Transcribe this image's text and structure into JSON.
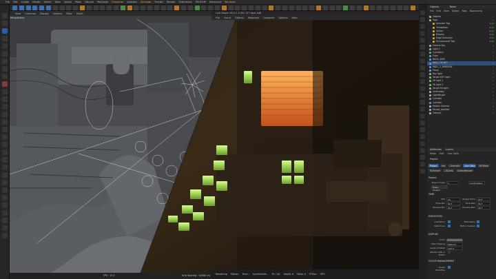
{
  "menubar": [
    "File",
    "Edit",
    "Create",
    "Modes",
    "Select",
    "Tools",
    "Spline",
    "Mesh",
    "Volume",
    "MoGraph",
    "Character",
    "Animate",
    "Simulate",
    "Tracker",
    "Render",
    "Extensions",
    "EXOFILM",
    "Enhanced",
    "Windows"
  ],
  "viewport_menu": [
    "View",
    "Cameras",
    "Display",
    "Options",
    "Filter",
    "Panel"
  ],
  "viewport_label": "Perspective",
  "render_title": "Live Viewer 2021.1.0 (Rd. 377 days left)",
  "render_menu": [
    "File",
    "Cloud",
    "Objects",
    "Materials",
    "Compare",
    "Options",
    "Help"
  ],
  "status_left": {
    "fps": "FPS : 13.5",
    "grid": "Grid Spacing : 10000 cm"
  },
  "status_right": [
    "Rendering",
    "Mb/sec",
    "Time :",
    "SyncFriends...",
    "Tri: 101",
    "Depth: 0",
    "Mesh: 0",
    "RTXon",
    "GPU"
  ],
  "objects_panel": {
    "title": "Objects",
    "tab2": "Takes",
    "menu": [
      "File",
      "Edit",
      "View",
      "Object",
      "Tags",
      "Bookmarks"
    ],
    "rows": [
      {
        "label": "Objects",
        "icon": "w"
      },
      {
        "label": "Tags",
        "icon": "o"
      },
      {
        "label": "Animate Tag",
        "icon": "o",
        "check": "3.00"
      },
      {
        "label": "Translation",
        "icon": "o",
        "check": "3.00"
      },
      {
        "label": "Spline",
        "icon": "o",
        "check": "3.00"
      },
      {
        "label": "Display",
        "icon": "o",
        "check": "3.00"
      },
      {
        "label": "Edge Selection",
        "icon": "o",
        "check": "3.00"
      },
      {
        "label": "Environment Tag",
        "icon": "o",
        "check": "3.00"
      },
      {
        "label": "Octane Sky",
        "icon": "w"
      },
      {
        "label": "Light 1",
        "icon": "g"
      },
      {
        "label": "Cylinder.1",
        "icon": "b"
      },
      {
        "label": "Floor",
        "icon": "b"
      },
      {
        "label": "BACK_SIDE",
        "icon": "b"
      },
      {
        "label": "WALL_FRONT",
        "icon": "b",
        "sel": true
      },
      {
        "label": "WALL_1_WINDOW",
        "icon": "b"
      },
      {
        "label": "Plane",
        "icon": "b"
      },
      {
        "label": "Key light",
        "icon": "g"
      },
      {
        "label": "Target KEY light",
        "icon": "g"
      },
      {
        "label": "Fill light 1",
        "icon": "g"
      },
      {
        "label": "Fill light 2",
        "icon": "g"
      },
      {
        "label": "Target fill light",
        "icon": "g"
      },
      {
        "label": "Octanesky",
        "icon": "w"
      },
      {
        "label": "LightTarget",
        "icon": "w"
      },
      {
        "label": "Cylinder",
        "icon": "b"
      },
      {
        "label": "Cylinder",
        "icon": "b"
      },
      {
        "label": "Motion Camera",
        "icon": "w"
      },
      {
        "label": "Mouse_position",
        "icon": "w"
      },
      {
        "label": "Camera",
        "icon": "w"
      }
    ]
  },
  "attributes": {
    "tabs": [
      "Attributes",
      "Layers"
    ],
    "menu": [
      "Mode",
      "Edit",
      "User Data"
    ],
    "project_label": "Project",
    "ptabs": [
      {
        "label": "Project",
        "on": true
      },
      {
        "label": "Info",
        "on": false
      },
      {
        "label": "Cinematic",
        "on": false
      },
      {
        "label": "User Data",
        "on": true
      },
      {
        "label": "Bit Mode",
        "on": false
      },
      {
        "label": "To Render",
        "on": false
      },
      {
        "label": "C4DInfo",
        "on": false
      },
      {
        "label": "OctaneRender",
        "on": false
      }
    ],
    "section_project": "Project",
    "project_scale_label": "Project Scale",
    "project_scale_value": "1",
    "project_scale_unit": "Centimeters",
    "scale_btn": "Scale Project...",
    "section_time": "TIME",
    "fps_label": "FPS",
    "fps_value": "24",
    "project_time_label": "Project Time",
    "project_time_value": "25 F",
    "min_time_label": "Time Min",
    "min_time_value": "50 F",
    "max_time_label": "Time Max",
    "max_time_value": "50 F",
    "prev_min_label": "Preview Min",
    "prev_min_value": "50 F",
    "prev_max_label": "Preview Max",
    "prev_max_value": "50 F",
    "section_exec": "EXECUTION",
    "anim_label": "Animation",
    "expr_label": "Expression",
    "deform_label": "Deformers",
    "motion_label": "Motion System",
    "section_display": "DISPLAY",
    "color_label": "Color",
    "view_clip_label": "View Clipping",
    "view_clip_value": "Medium",
    "lod_label": "Level of Detail",
    "lod_value": "100 %",
    "render_lod_label": "Render LOD in Editor",
    "section_color": "COLOR MANAGEMENT",
    "linear_label": "Linear Workflow"
  },
  "colors": {
    "accent": "#3a6fb0",
    "highlight": "#e6a93a"
  }
}
